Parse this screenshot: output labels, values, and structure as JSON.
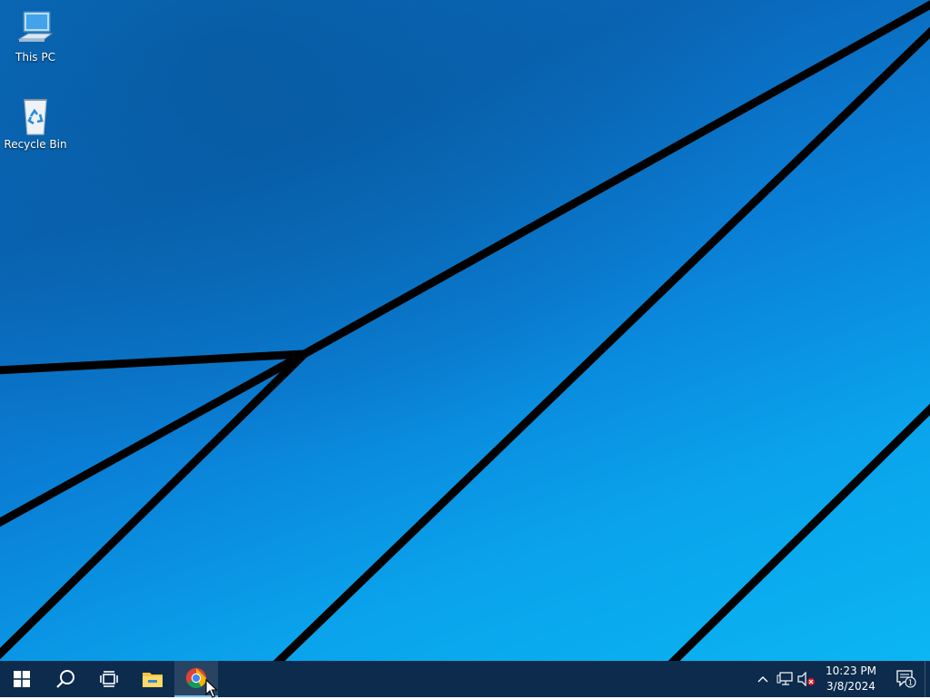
{
  "desktop": {
    "icons": [
      {
        "label": "This PC",
        "icon": "computer-icon"
      },
      {
        "label": "Recycle Bin",
        "icon": "recycle-bin-icon"
      }
    ]
  },
  "taskbar": {
    "buttons": [
      {
        "name": "start-button",
        "icon": "windows-logo-icon"
      },
      {
        "name": "search-button",
        "icon": "search-icon"
      },
      {
        "name": "task-view-button",
        "icon": "task-view-icon"
      },
      {
        "name": "file-explorer-button",
        "icon": "folder-icon"
      },
      {
        "name": "chrome-button",
        "icon": "chrome-icon",
        "active": true
      }
    ],
    "tray": {
      "icons": [
        "chevron-up-icon",
        "network-icon",
        "volume-muted-icon"
      ],
      "time": "10:23 PM",
      "date": "3/8/2024",
      "notification_count": "1"
    }
  },
  "colors": {
    "taskbar": "#0c2b4d",
    "accent": "#76b9ed",
    "desktop_top": "#0b6fc4",
    "desktop_bottom": "#0bb6f2"
  }
}
